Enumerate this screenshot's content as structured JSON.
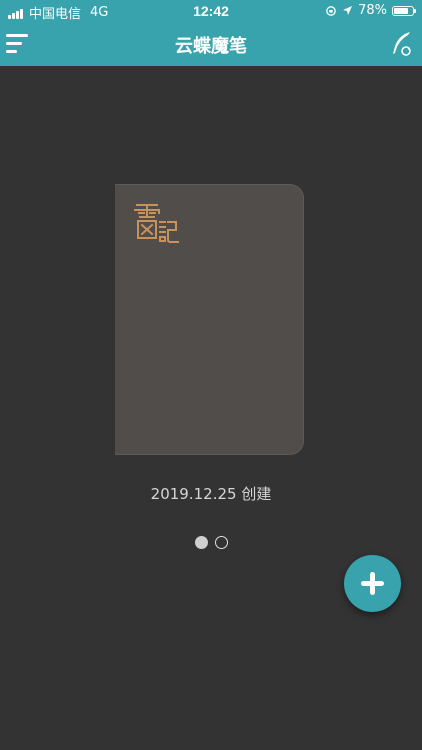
{
  "status_bar": {
    "carrier": "中国电信",
    "network": "4G",
    "time": "12:42",
    "battery_percent": "78%",
    "battery_level": 0.78
  },
  "nav": {
    "title": "云蝶魔笔"
  },
  "notebook": {
    "created_label": "2019.12.25 创建",
    "cover_color": "#514d4b",
    "logo_color": "#c8925a"
  },
  "pager": {
    "total": 2,
    "active_index": 0
  },
  "theme": {
    "accent": "#38a3ad",
    "background": "#333333"
  },
  "icons": {
    "menu": "menu-icon",
    "quill": "quill-sync-icon",
    "add": "plus-icon"
  }
}
